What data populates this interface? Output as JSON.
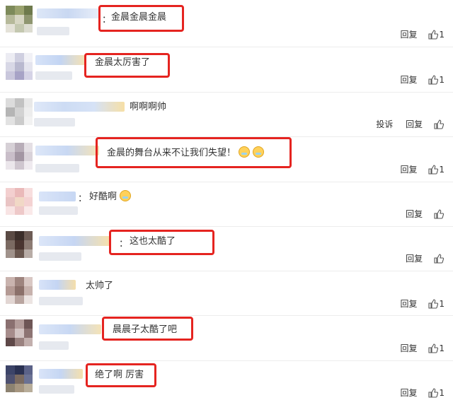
{
  "actions": {
    "reply": "回复",
    "report": "投诉"
  },
  "colors": {
    "highlight": "#e52420",
    "divider": "#ececec"
  },
  "comments": [
    {
      "text": "金晨金晨金晨",
      "colon": "：",
      "likes": "1",
      "highlighted": true
    },
    {
      "text": "金晨太厉害了",
      "colon": "",
      "likes": "1",
      "highlighted": true
    },
    {
      "text": "啊啊啊帅",
      "colon": "",
      "likes": "",
      "highlighted": false,
      "has_report": true
    },
    {
      "text": "金晨的舞台从来不让我们失望！",
      "colon": "",
      "likes": "1",
      "highlighted": true,
      "emojis": [
        "crying-emoji",
        "crying-emoji"
      ]
    },
    {
      "text": "好酷啊",
      "colon": "：",
      "likes": "",
      "highlighted": false,
      "emojis": [
        "surprised-emoji"
      ]
    },
    {
      "text": "这也太酷了",
      "colon": "：",
      "likes": "",
      "highlighted": true
    },
    {
      "text": "太帅了",
      "colon": "",
      "likes": "1",
      "highlighted": false
    },
    {
      "text": "晨晨子太酷了吧",
      "colon": "",
      "likes": "1",
      "highlighted": true
    },
    {
      "text": "绝了啊 厉害",
      "colon": "",
      "likes": "1",
      "highlighted": true
    }
  ]
}
